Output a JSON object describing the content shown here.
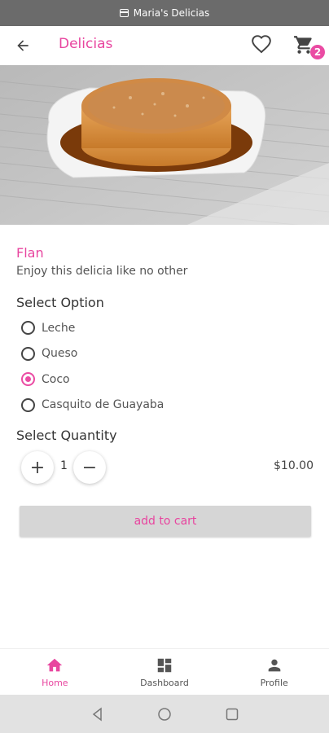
{
  "status_bar": {
    "title": "Maria's Delicias",
    "icon": "calendar-icon"
  },
  "app_bar": {
    "title": "Delicias",
    "back_icon": "arrow-left-icon",
    "favorite_icon": "heart-outline-icon",
    "cart_icon": "cart-icon",
    "cart_count": "2"
  },
  "product": {
    "image": "flan-photo",
    "name": "Flan",
    "description": "Enjoy this delicia like no other"
  },
  "options": {
    "heading": "Select Option",
    "items": [
      {
        "label": "Leche",
        "selected": false
      },
      {
        "label": "Queso",
        "selected": false
      },
      {
        "label": "Coco",
        "selected": true
      },
      {
        "label": "Casquito de Guayaba",
        "selected": false
      }
    ]
  },
  "quantity": {
    "heading": "Select Quantity",
    "increment_symbol": "+",
    "decrement_symbol": "−",
    "value": "1",
    "price": "$10.00"
  },
  "add_to_cart": {
    "label": "add to cart"
  },
  "bottom_nav": {
    "items": [
      {
        "label": "Home",
        "icon": "home-icon",
        "active": true
      },
      {
        "label": "Dashboard",
        "icon": "dashboard-icon",
        "active": false
      },
      {
        "label": "Profile",
        "icon": "person-icon",
        "active": false
      }
    ]
  },
  "colors": {
    "accent": "#e8459f",
    "status_bar": "#6b6b6b",
    "button_bg": "#d6d6d6",
    "system_nav": "#e2e2e2"
  }
}
